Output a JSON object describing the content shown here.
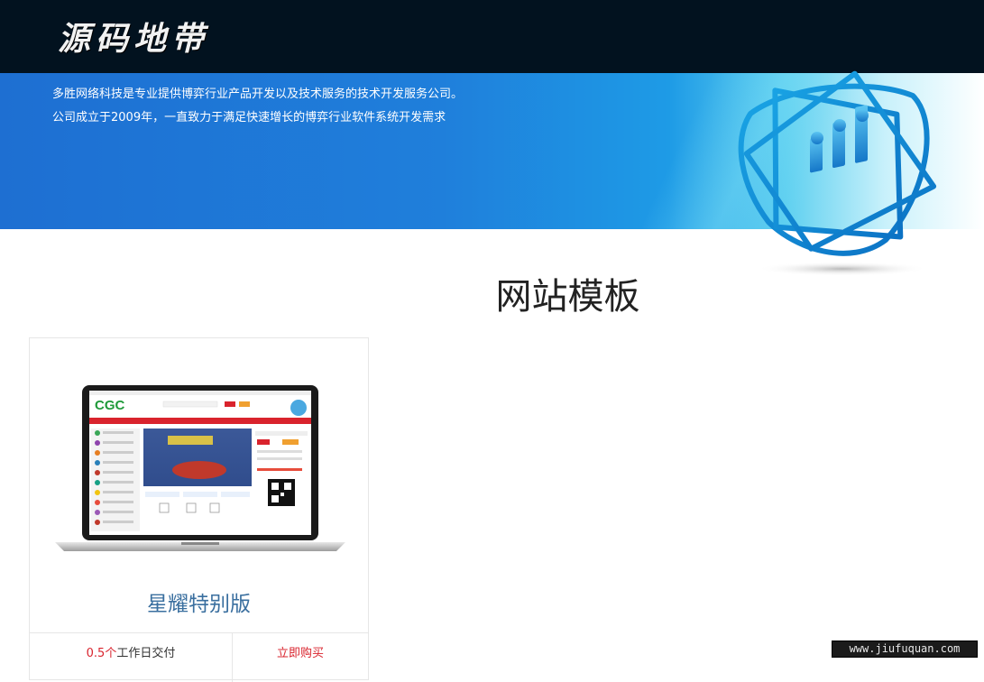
{
  "header": {
    "logo_text": "源码地带"
  },
  "banner": {
    "intro_text": "多胜网络科技是专业提供博弈行业产品开发以及技术服务的技术开发服务公司。公司成立于2009年，一直致力于满足快速增长的博弈行业软件系统开发需求",
    "emblem_icon": "chart-people-emblem-icon"
  },
  "section": {
    "title": "网站模板"
  },
  "products": [
    {
      "name": "星耀特别版",
      "preview_brand": "CGC",
      "delivery_number": "0.5个",
      "delivery_text": "工作日交付",
      "buy_label": "立即购买"
    }
  ],
  "watermark": {
    "text": "www.jiufuquan.com"
  },
  "colors": {
    "topbar": "#02121f",
    "banner_blue": "#1e6fd2",
    "accent_red": "#d9232d",
    "product_title": "#3a6f9f"
  }
}
